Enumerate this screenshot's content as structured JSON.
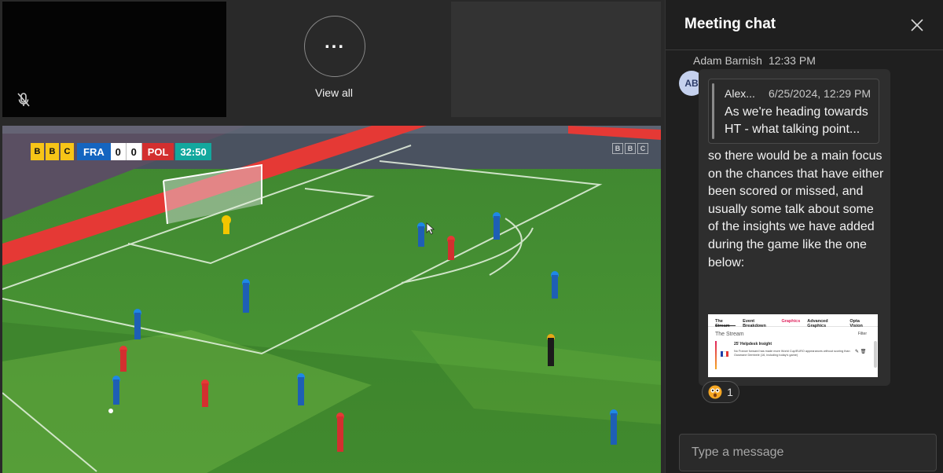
{
  "stage": {
    "view_all_label": "View all",
    "scorebug": {
      "broadcaster": [
        "B",
        "B",
        "C"
      ],
      "home_team": "FRA",
      "home_score": "0",
      "away_score": "0",
      "away_team": "POL",
      "clock": "32:50"
    },
    "watermark": [
      "B",
      "B",
      "C"
    ],
    "colors": {
      "pitch_light": "#4f9a38",
      "pitch_dark": "#2e6b20",
      "home_blue": "#1565c0",
      "away_red": "#d32f2f",
      "clock_teal": "#13a89e",
      "bbc_yellow": "#f7c517"
    },
    "icons": {
      "mic": "mic-off-icon",
      "more": "ellipsis-icon"
    }
  },
  "chat": {
    "title": "Meeting chat",
    "close_icon": "close-icon",
    "message": {
      "sender": "Adam Barnish",
      "time": "12:33 PM",
      "avatar_initials": "AB",
      "quote": {
        "author": "Alex...",
        "time": "6/25/2024, 12:29 PM",
        "text": "As we're heading towards HT - what talking point..."
      },
      "body": "so there would be a main focus on the chances that have either been scored or missed, and usually some talk about some of the insights we have added during the game like the one below:",
      "attachment": {
        "tabs": [
          "The Stream",
          "Event Breakdown",
          "Graphics",
          "Advanced Graphics",
          "Opta Vision"
        ],
        "header": "The Stream",
        "filter_label": "Filter",
        "minute": "25'",
        "item_title": "Helpdesk Insight",
        "item_text": "No France forward has made more World Cup/EURO appearances without scoring than Ousmane Dembele (16, including today's game)",
        "actions": "✎ 🗑"
      },
      "reaction": {
        "icon": "astonished-face-icon",
        "count": "1"
      }
    },
    "compose": {
      "placeholder": "Type a message"
    },
    "colors": {
      "panel_bg": "#1f1f1f",
      "bubble_bg": "#2e2e2e",
      "avatar_bg": "#c5d1ee"
    }
  }
}
